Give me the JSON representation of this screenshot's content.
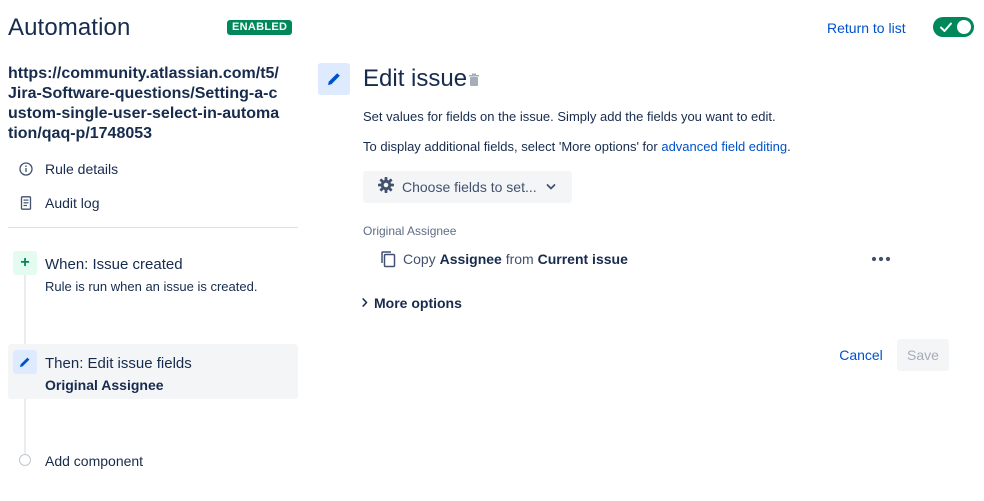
{
  "header": {
    "title": "Automation",
    "status_badge": "ENABLED",
    "return_link": "Return to list",
    "toggle_state": "on"
  },
  "sidebar": {
    "rule_name": "https://community.atlassian.com/t5/Jira-Software-questions/Setting-a-custom-single-user-select-in-automation/qaq-p/1748053",
    "nav": [
      {
        "label": "Rule details",
        "icon": "info-icon"
      },
      {
        "label": "Audit log",
        "icon": "document-icon"
      }
    ],
    "components": {
      "trigger": {
        "title": "When: Issue created",
        "subtitle": "Rule is run when an issue is created.",
        "icon": "plus-icon"
      },
      "action": {
        "title": "Then: Edit issue fields",
        "subtitle": "Original Assignee",
        "icon": "pencil-icon"
      },
      "add": {
        "label": "Add component"
      }
    }
  },
  "main": {
    "title": "Edit issue",
    "description": "Set values for fields on the issue. Simply add the fields you want to edit.",
    "advanced_prefix": "To display additional fields, select 'More options' for ",
    "advanced_link": "advanced field editing",
    "advanced_suffix": ".",
    "choose_fields_label": "Choose fields to set...",
    "field": {
      "heading": "Original Assignee",
      "copy_word": "Copy",
      "source_field": "Assignee",
      "from_word": "from",
      "source_issue": "Current issue"
    },
    "more_options": "More options",
    "cancel_label": "Cancel",
    "save_label": "Save"
  },
  "colors": {
    "accent": "#0052cc",
    "success": "#00875a",
    "text": "#172b4d",
    "subtle_bg": "#f4f5f7"
  }
}
